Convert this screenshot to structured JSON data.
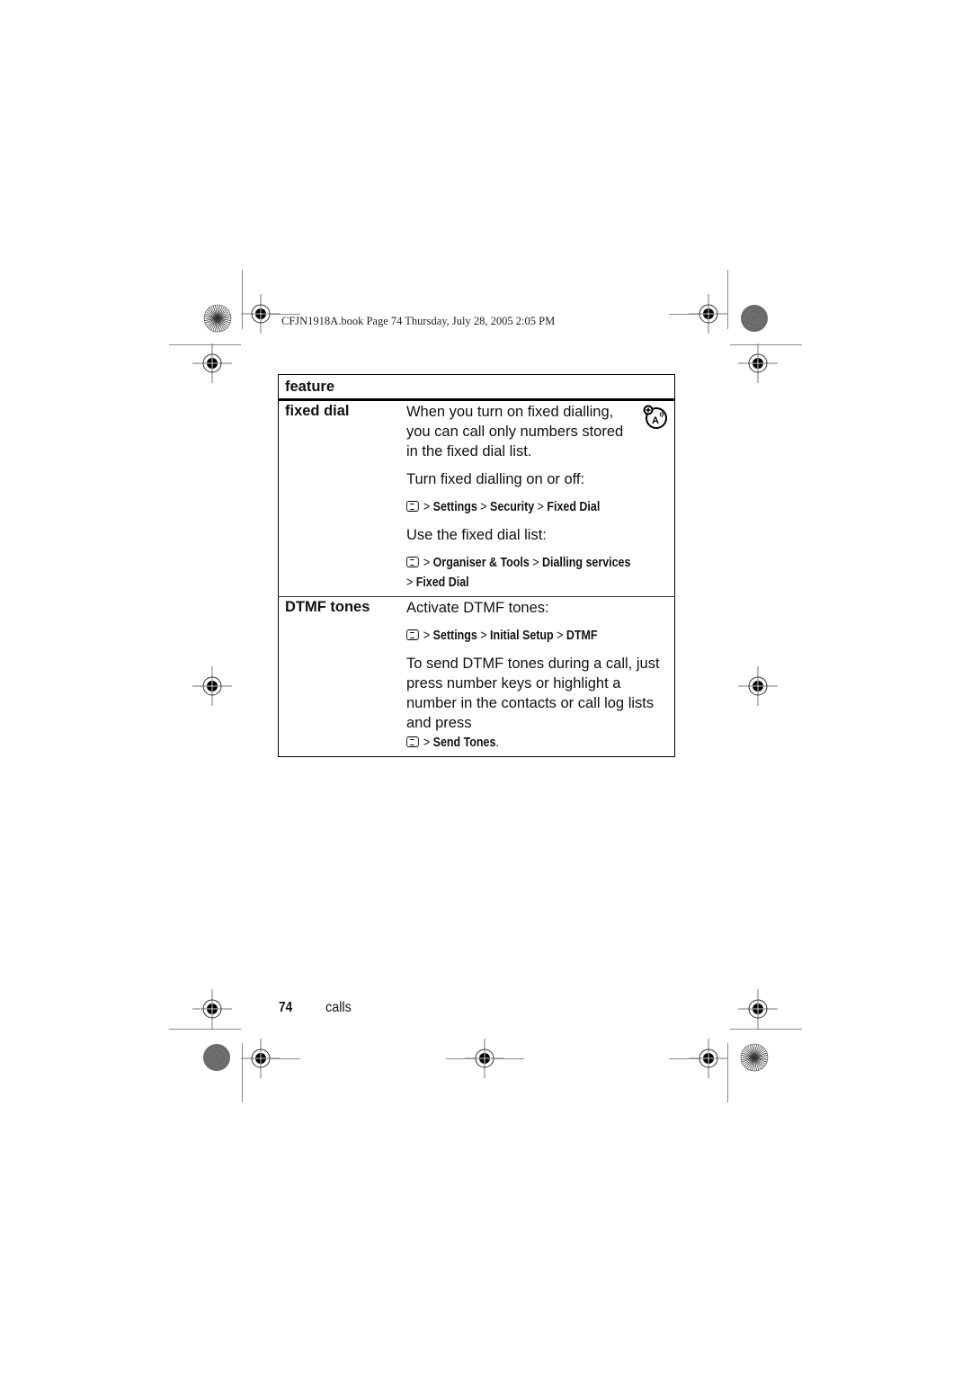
{
  "print_header": "CFJN1918A.book  Page 74  Thursday, July 28, 2005  2:05 PM",
  "table": {
    "header": "feature",
    "rows": [
      {
        "feature": "fixed dial",
        "icon": "network-feature-icon",
        "intro": "When you turn on fixed dialling, you can call only numbers stored in the fixed dial list.",
        "step1_text": "Turn fixed dialling on or off:",
        "step1_path": [
          "Settings",
          "Security",
          "Fixed Dial"
        ],
        "step2_text": "Use the fixed dial list:",
        "step2_path": [
          "Organiser & Tools",
          "Dialling services",
          "Fixed Dial"
        ]
      },
      {
        "feature": "DTMF tones",
        "step1_text": "Activate DTMF tones:",
        "step1_path": [
          "Settings",
          "Initial Setup",
          "DTMF"
        ],
        "step2_text": "To send DTMF tones during a call, just press number keys or highlight a number in the contacts or call log lists and press",
        "step2_path": [
          "Send Tones"
        ],
        "step2_end": "."
      }
    ]
  },
  "footer": {
    "page_number": "74",
    "section": "calls"
  },
  "separator": ">",
  "menu_key_icon": "menu-key-icon"
}
